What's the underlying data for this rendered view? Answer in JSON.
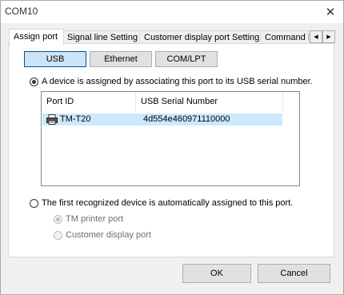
{
  "window": {
    "title": "COM10",
    "close_icon": "close-icon"
  },
  "tabs": [
    {
      "label": "Assign port",
      "active": true
    },
    {
      "label": "Signal line Setting",
      "active": false
    },
    {
      "label": "Customer display port Setting",
      "active": false
    },
    {
      "label": "Command I",
      "active": false
    }
  ],
  "tab_scroll": {
    "left": "◀",
    "right": "▶"
  },
  "port_types": [
    {
      "label": "USB",
      "active": true
    },
    {
      "label": "Ethernet",
      "active": false
    },
    {
      "label": "COM/LPT",
      "active": false
    }
  ],
  "assign_options": {
    "by_serial": {
      "label": "A device is assigned by associating this port to its USB serial number.",
      "checked": true
    },
    "auto": {
      "label": "The first recognized device is automatically assigned to this port.",
      "checked": false
    }
  },
  "device_list": {
    "columns": [
      "Port ID",
      "USB Serial Number"
    ],
    "rows": [
      {
        "port_id": "TM-T20",
        "serial": "4d554e460971110000",
        "icon": "printer-icon",
        "selected": true
      }
    ]
  },
  "auto_suboptions": [
    {
      "label": "TM printer port",
      "checked": true,
      "disabled": true
    },
    {
      "label": "Customer display port",
      "checked": false,
      "disabled": true
    }
  ],
  "buttons": {
    "ok": "OK",
    "cancel": "Cancel"
  },
  "colors": {
    "selection": "#cce8ff",
    "active_button": "#cce4f7",
    "accent_border": "#005499"
  }
}
